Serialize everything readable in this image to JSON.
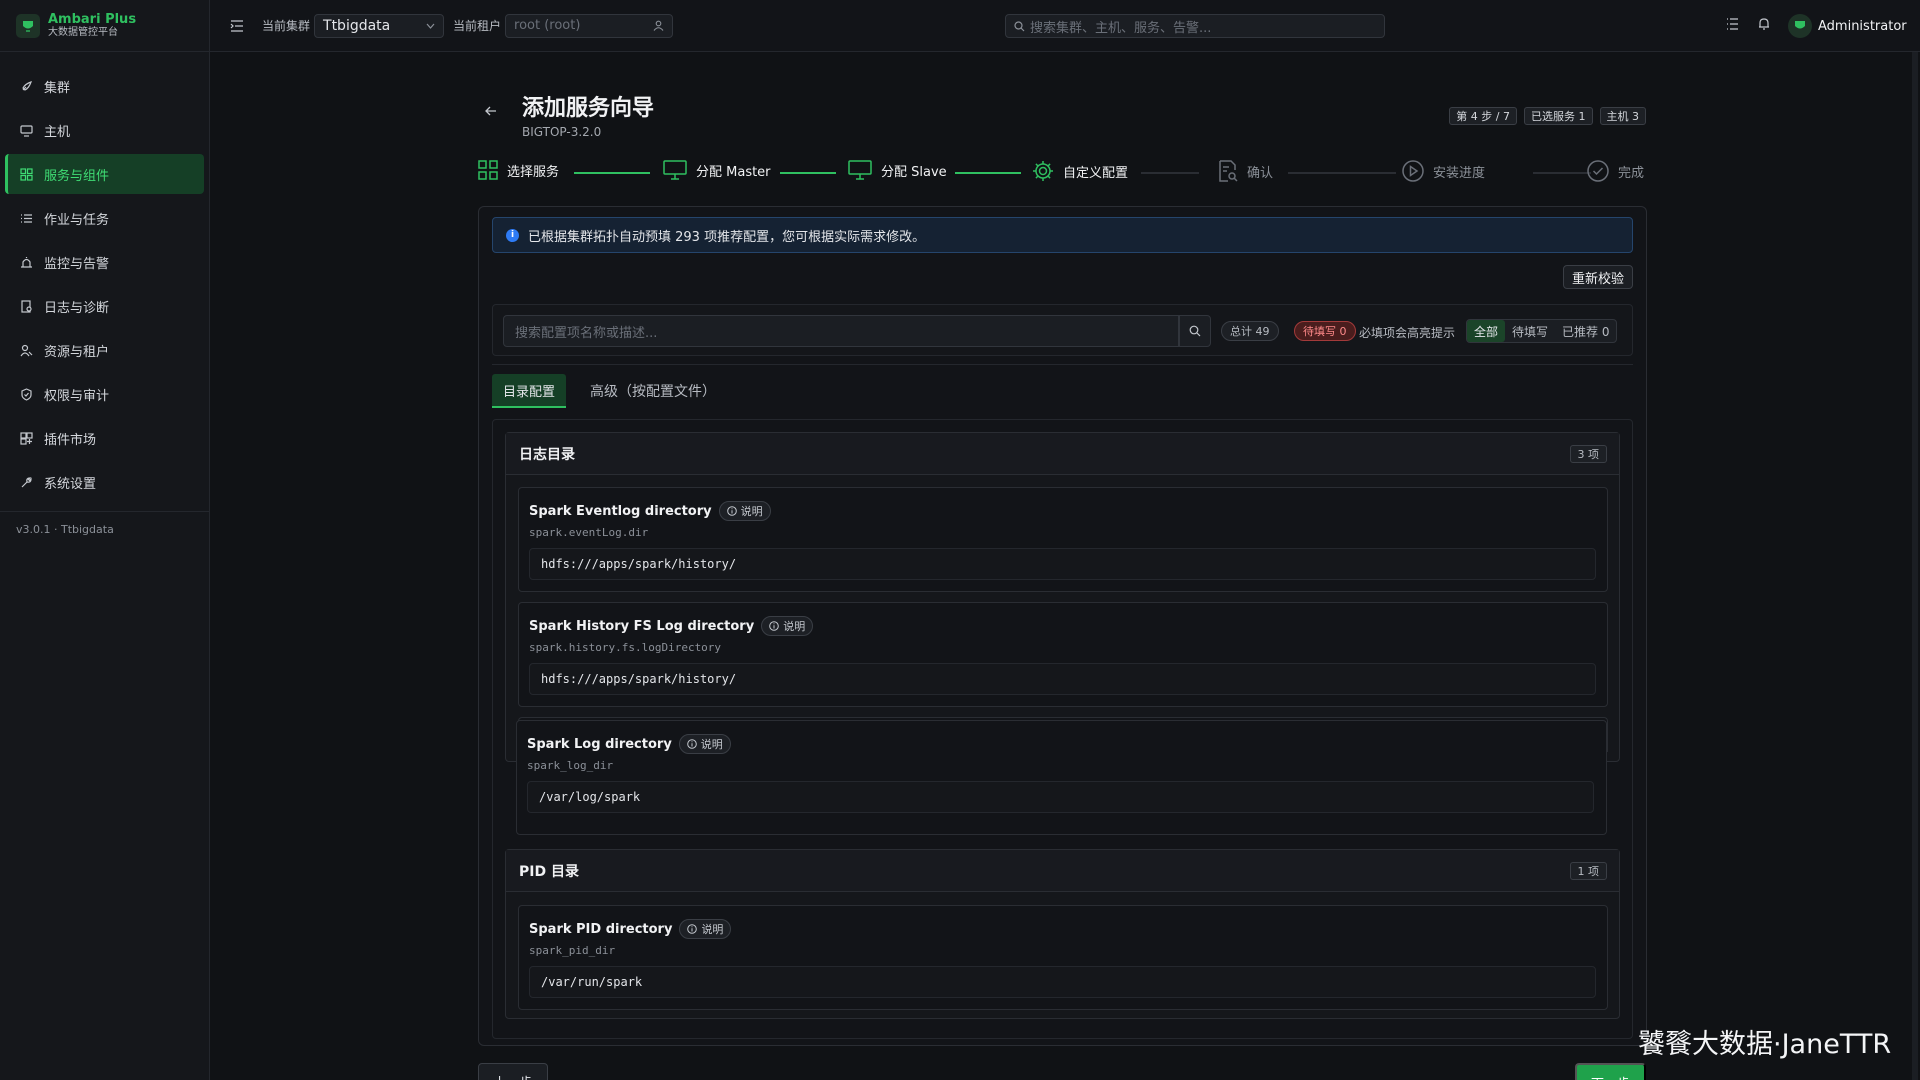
{
  "brand": {
    "title": "Ambari Plus",
    "subtitle": "大数据管控平台"
  },
  "sidebar": {
    "items": [
      {
        "label": "集群",
        "icon": "rocket-icon"
      },
      {
        "label": "主机",
        "icon": "monitor-icon"
      },
      {
        "label": "服务与组件",
        "icon": "grid-icon",
        "active": true
      },
      {
        "label": "作业与任务",
        "icon": "list-icon"
      },
      {
        "label": "监控与告警",
        "icon": "alarm-icon"
      },
      {
        "label": "日志与诊断",
        "icon": "log-icon"
      },
      {
        "label": "资源与租户",
        "icon": "users-icon"
      },
      {
        "label": "权限与审计",
        "icon": "shield-icon"
      },
      {
        "label": "插件市场",
        "icon": "plugin-icon"
      },
      {
        "label": "系统设置",
        "icon": "wrench-icon"
      }
    ],
    "version": "v3.0.1 · Ttbigdata"
  },
  "topbar": {
    "cluster_label": "当前集群",
    "cluster_value": "Ttbigdata",
    "tenant_label": "当前租户",
    "tenant_value": "root (root)",
    "search_placeholder": "搜索集群、主机、服务、告警...",
    "user": "Administrator"
  },
  "wizard": {
    "title": "添加服务向导",
    "stack": "BIGTOP-3.2.0",
    "chips": [
      "第 4 步 / 7",
      "已选服务 1",
      "主机 3"
    ],
    "steps": [
      {
        "label": "选择服务",
        "state": "done"
      },
      {
        "label": "分配 Master",
        "state": "done"
      },
      {
        "label": "分配 Slave",
        "state": "done"
      },
      {
        "label": "自定义配置",
        "state": "current"
      },
      {
        "label": "确认",
        "state": "pending"
      },
      {
        "label": "安装进度",
        "state": "pending"
      },
      {
        "label": "完成",
        "state": "pending"
      }
    ]
  },
  "banner": {
    "text": "已根据集群拓扑自动预填 293 项推荐配置，您可根据实际需求修改。"
  },
  "actions": {
    "revalidate": "重新校验",
    "prev": "上一步",
    "next": "下一步"
  },
  "filter": {
    "placeholder": "搜索配置项名称或描述...",
    "total": "总计 49",
    "pending": "待填写 0",
    "hint": "必填项会高亮提示",
    "segments": [
      "全部",
      "待填写",
      "已推荐 0"
    ]
  },
  "tabs": [
    "目录配置",
    "高级（按配置文件）"
  ],
  "groups": [
    {
      "title": "日志目录",
      "count": "3 项",
      "fields": [
        {
          "label": "Spark Eventlog directory",
          "help": "说明",
          "key": "spark.eventLog.dir",
          "value": "hdfs:///apps/spark/history/"
        },
        {
          "label": "Spark History FS Log directory",
          "help": "说明",
          "key": "spark.history.fs.logDirectory",
          "value": "hdfs:///apps/spark/history/"
        },
        {
          "label": "Spark Log directory",
          "help": "说明",
          "key": "spark_log_dir",
          "value": "/var/log/spark"
        }
      ]
    },
    {
      "title": "PID 目录",
      "count": "1 项",
      "fields": [
        {
          "label": "Spark PID directory",
          "help": "说明",
          "key": "spark_pid_dir",
          "value": "/var/run/spark"
        }
      ]
    }
  ],
  "watermark": "饕餮大数据·JaneTTR",
  "colors": {
    "accent": "#2fc060",
    "danger": "#ff8a8a",
    "info": "#2e7bf5",
    "background": "#101215"
  }
}
